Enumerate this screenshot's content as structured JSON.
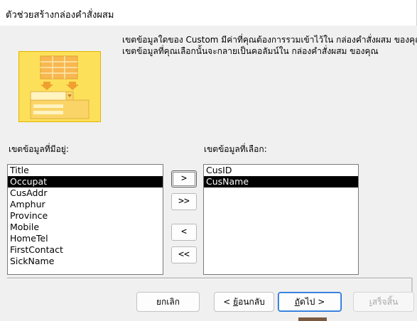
{
  "window": {
    "title": "ตัวช่วยสร้างกล่องคำสั่งผสม"
  },
  "description": {
    "line1": "เขตข้อมูลใดของ Custom มีค่าที่คุณต้องการรวมเข้าไว้ใน กล่องคำสั่งผสม ของคุณ",
    "line2": "เขตข้อมูลที่คุณเลือกนั้นจะกลายเป็นคอลัมน์ใน กล่องคำสั่งผสม ของคุณ"
  },
  "available": {
    "label": "เขตข้อมูลที่มีอยู่:",
    "items": [
      "Title",
      "Occupat",
      "CusAddr",
      "Amphur",
      "Province",
      "Mobile",
      "HomeTel",
      "FirstContact",
      "SickName"
    ],
    "selected_index": 1
  },
  "selected": {
    "label": "เขตข้อมูลที่เลือก:",
    "items": [
      "CusID",
      "CusName"
    ],
    "selected_index": 1
  },
  "move_buttons": {
    "add": ">",
    "add_all": ">>",
    "remove": "<",
    "remove_all": "<<"
  },
  "footer": {
    "cancel": "ยกเลิก",
    "back_prefix": "< ",
    "back_hotkey": "ย้",
    "back_rest": "อนกลับ",
    "next_hotkey": "ถั",
    "next_rest": "ดไป >",
    "finish_hotkey": "เ",
    "finish_rest": "สร็จสิ้น",
    "finish_disabled": true
  },
  "colors": {
    "illustration_fill": "#fde059",
    "selection": "#000000",
    "primary_border": "#1b6ed6"
  }
}
